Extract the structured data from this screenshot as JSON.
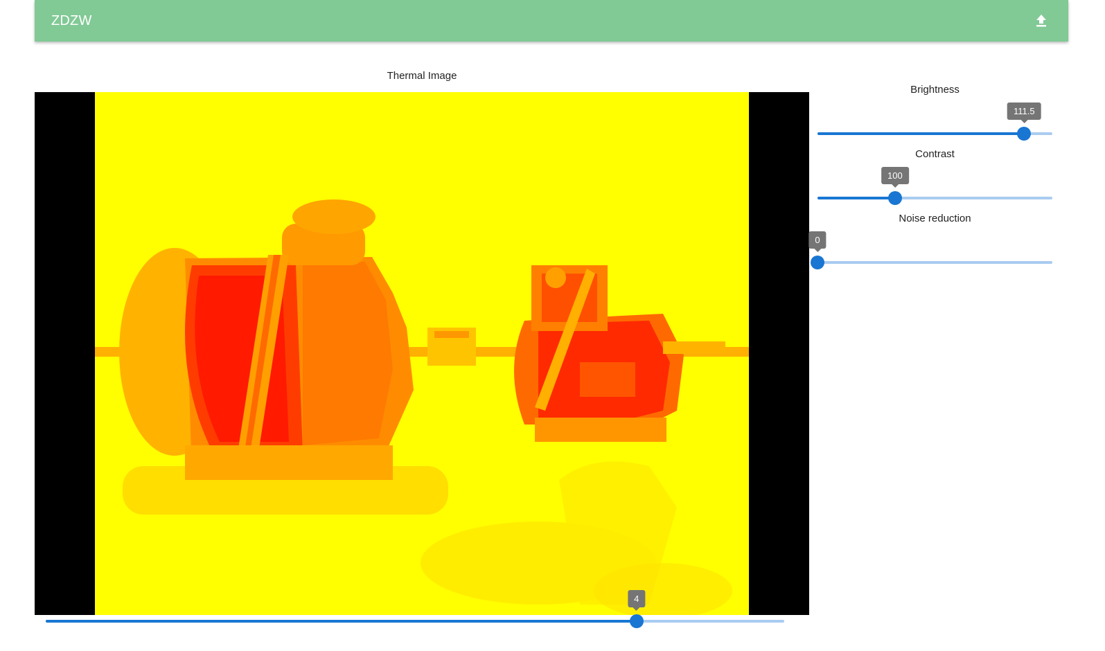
{
  "app": {
    "title": "ZDZW",
    "upload_icon": "upload-icon"
  },
  "viewer": {
    "title": "Thermal Image"
  },
  "controls": {
    "brightness": {
      "label": "Brightness",
      "value": "111.5",
      "fraction": 0.88
    },
    "contrast": {
      "label": "Contrast",
      "value": "100",
      "fraction": 0.33
    },
    "noise_reduction": {
      "label": "Noise reduction",
      "value": "0",
      "fraction": 0.0
    }
  },
  "frame_slider": {
    "value": "4",
    "fraction": 0.8
  },
  "colors": {
    "appbar": "#81c995",
    "slider": "#1976d2",
    "slider_rail": "#a9ccf0",
    "tooltip": "#757575"
  }
}
